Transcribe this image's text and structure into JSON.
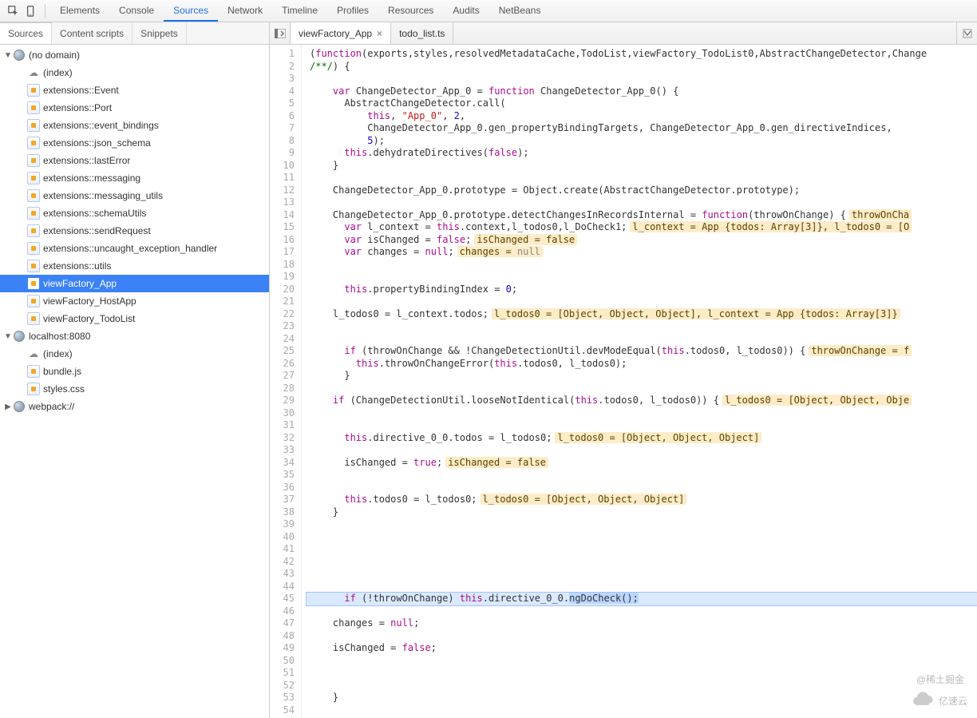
{
  "topTabs": [
    "Elements",
    "Console",
    "Sources",
    "Network",
    "Timeline",
    "Profiles",
    "Resources",
    "Audits",
    "NetBeans"
  ],
  "topActive": "Sources",
  "subTabs": [
    "Sources",
    "Content scripts",
    "Snippets"
  ],
  "subActive": "Sources",
  "fileTabs": [
    {
      "label": "viewFactory_App",
      "active": true,
      "closable": true
    },
    {
      "label": "todo_list.ts",
      "active": false,
      "closable": false
    }
  ],
  "tree": [
    {
      "type": "domain",
      "label": "(no domain)",
      "expanded": true,
      "children": [
        {
          "type": "file",
          "label": "(index)",
          "icon": "cloud"
        },
        {
          "type": "file",
          "label": "extensions::Event"
        },
        {
          "type": "file",
          "label": "extensions::Port"
        },
        {
          "type": "file",
          "label": "extensions::event_bindings"
        },
        {
          "type": "file",
          "label": "extensions::json_schema"
        },
        {
          "type": "file",
          "label": "extensions::lastError"
        },
        {
          "type": "file",
          "label": "extensions::messaging"
        },
        {
          "type": "file",
          "label": "extensions::messaging_utils"
        },
        {
          "type": "file",
          "label": "extensions::schemaUtils"
        },
        {
          "type": "file",
          "label": "extensions::sendRequest"
        },
        {
          "type": "file",
          "label": "extensions::uncaught_exception_handler"
        },
        {
          "type": "file",
          "label": "extensions::utils"
        },
        {
          "type": "file",
          "label": "viewFactory_App",
          "selected": true
        },
        {
          "type": "file",
          "label": "viewFactory_HostApp"
        },
        {
          "type": "file",
          "label": "viewFactory_TodoList"
        }
      ]
    },
    {
      "type": "domain",
      "label": "localhost:8080",
      "expanded": true,
      "children": [
        {
          "type": "file",
          "label": "(index)",
          "icon": "cloud"
        },
        {
          "type": "file",
          "label": "bundle.js"
        },
        {
          "type": "file",
          "label": "styles.css"
        }
      ]
    },
    {
      "type": "domain",
      "label": "webpack://",
      "expanded": false,
      "children": []
    }
  ],
  "code": {
    "startLine": 1,
    "highlightLine": 45,
    "lines": [
      [
        {
          "t": "(",
          "c": ""
        },
        {
          "t": "function",
          "c": "fn"
        },
        {
          "t": "(exports,styles,resolvedMetadataCache,TodoList,viewFactory_TodoList0,AbstractChangeDetector,Change",
          "c": ""
        }
      ],
      [
        {
          "t": "/**/",
          "c": "cmt"
        },
        {
          "t": ") {",
          "c": ""
        }
      ],
      [],
      [
        {
          "t": "    ",
          "c": ""
        },
        {
          "t": "var",
          "c": "kw"
        },
        {
          "t": " ChangeDetector_App_0 = ",
          "c": ""
        },
        {
          "t": "function",
          "c": "fn"
        },
        {
          "t": " ChangeDetector_App_0() {",
          "c": ""
        }
      ],
      [
        {
          "t": "      AbstractChangeDetector.call(",
          "c": ""
        }
      ],
      [
        {
          "t": "          ",
          "c": ""
        },
        {
          "t": "this",
          "c": "this"
        },
        {
          "t": ", ",
          "c": ""
        },
        {
          "t": "\"App_0\"",
          "c": "str"
        },
        {
          "t": ", ",
          "c": ""
        },
        {
          "t": "2",
          "c": "num"
        },
        {
          "t": ",",
          "c": ""
        }
      ],
      [
        {
          "t": "          ChangeDetector_App_0.gen_propertyBindingTargets, ChangeDetector_App_0.gen_directiveIndices,",
          "c": ""
        }
      ],
      [
        {
          "t": "          ",
          "c": ""
        },
        {
          "t": "5",
          "c": "num"
        },
        {
          "t": ");",
          "c": ""
        }
      ],
      [
        {
          "t": "      ",
          "c": ""
        },
        {
          "t": "this",
          "c": "this"
        },
        {
          "t": ".dehydrateDirectives(",
          "c": ""
        },
        {
          "t": "false",
          "c": "kw"
        },
        {
          "t": ");",
          "c": ""
        }
      ],
      [
        {
          "t": "    }",
          "c": ""
        }
      ],
      [],
      [
        {
          "t": "    ChangeDetector_App_0.prototype = Object.create(AbstractChangeDetector.prototype);",
          "c": ""
        }
      ],
      [],
      [
        {
          "t": "    ChangeDetector_App_0.prototype.detectChangesInRecordsInternal = ",
          "c": ""
        },
        {
          "t": "function",
          "c": "fn"
        },
        {
          "t": "(throwOnChange) {",
          "c": ""
        },
        {
          "inl": "throwOnCha"
        }
      ],
      [
        {
          "t": "      ",
          "c": ""
        },
        {
          "t": "var",
          "c": "kw"
        },
        {
          "t": " l_context = ",
          "c": ""
        },
        {
          "t": "this",
          "c": "this"
        },
        {
          "t": ".context,l_todos0,l_DoCheck1;",
          "c": ""
        },
        {
          "inl": "l_context = App {todos: Array[3]}, l_todos0 = [O"
        }
      ],
      [
        {
          "t": "      ",
          "c": ""
        },
        {
          "t": "var",
          "c": "kw"
        },
        {
          "t": " isChanged = ",
          "c": ""
        },
        {
          "t": "false",
          "c": "kw"
        },
        {
          "t": ";",
          "c": ""
        },
        {
          "inl": "isChanged = false"
        }
      ],
      [
        {
          "t": "      ",
          "c": ""
        },
        {
          "t": "var",
          "c": "kw"
        },
        {
          "t": " changes = ",
          "c": ""
        },
        {
          "t": "null",
          "c": "kw"
        },
        {
          "t": ";",
          "c": ""
        },
        {
          "inl": "changes = ",
          "inlx": "null"
        }
      ],
      [],
      [],
      [
        {
          "t": "      ",
          "c": ""
        },
        {
          "t": "this",
          "c": "this"
        },
        {
          "t": ".propertyBindingIndex = ",
          "c": ""
        },
        {
          "t": "0",
          "c": "num"
        },
        {
          "t": ";",
          "c": ""
        }
      ],
      [],
      [
        {
          "t": "    l_todos0 = l_context.todos;",
          "c": ""
        },
        {
          "inl": "l_todos0 = [Object, Object, Object], l_context = App {todos: Array[3]}"
        }
      ],
      [],
      [],
      [
        {
          "t": "      ",
          "c": ""
        },
        {
          "t": "if",
          "c": "kw"
        },
        {
          "t": " (throwOnChange && !ChangeDetectionUtil.devModeEqual(",
          "c": ""
        },
        {
          "t": "this",
          "c": "this"
        },
        {
          "t": ".todos0, l_todos0)) {",
          "c": ""
        },
        {
          "inl": "throwOnChange = f"
        }
      ],
      [
        {
          "t": "        ",
          "c": ""
        },
        {
          "t": "this",
          "c": "this"
        },
        {
          "t": ".throwOnChangeError(",
          "c": ""
        },
        {
          "t": "this",
          "c": "this"
        },
        {
          "t": ".todos0, l_todos0);",
          "c": ""
        }
      ],
      [
        {
          "t": "      }",
          "c": ""
        }
      ],
      [],
      [
        {
          "t": "    ",
          "c": ""
        },
        {
          "t": "if",
          "c": "kw"
        },
        {
          "t": " (ChangeDetectionUtil.looseNotIdentical(",
          "c": ""
        },
        {
          "t": "this",
          "c": "this"
        },
        {
          "t": ".todos0, l_todos0)) {",
          "c": ""
        },
        {
          "inl": "l_todos0 = [Object, Object, Obje"
        }
      ],
      [],
      [],
      [
        {
          "t": "      ",
          "c": ""
        },
        {
          "t": "this",
          "c": "this"
        },
        {
          "t": ".directive_0_0.todos = l_todos0;",
          "c": ""
        },
        {
          "inl": "l_todos0 = [Object, Object, Object]"
        }
      ],
      [],
      [
        {
          "t": "      isChanged = ",
          "c": ""
        },
        {
          "t": "true",
          "c": "kw"
        },
        {
          "t": ";",
          "c": ""
        },
        {
          "inl": "isChanged = false"
        }
      ],
      [],
      [],
      [
        {
          "t": "      ",
          "c": ""
        },
        {
          "t": "this",
          "c": "this"
        },
        {
          "t": ".todos0 = l_todos0;",
          "c": ""
        },
        {
          "inl": "l_todos0 = [Object, Object, Object]"
        }
      ],
      [
        {
          "t": "    }",
          "c": ""
        }
      ],
      [],
      [],
      [],
      [],
      [],
      [],
      [
        {
          "t": "      ",
          "c": ""
        },
        {
          "t": "if",
          "c": "kw"
        },
        {
          "t": " (!throwOnChange) ",
          "c": ""
        },
        {
          "t": "this",
          "c": "this"
        },
        {
          "t": ".directive_0_0.",
          "c": ""
        },
        {
          "sel": "ngDoCheck();"
        }
      ],
      [],
      [
        {
          "t": "    changes = ",
          "c": ""
        },
        {
          "t": "null",
          "c": "kw"
        },
        {
          "t": ";",
          "c": ""
        }
      ],
      [],
      [
        {
          "t": "    isChanged = ",
          "c": ""
        },
        {
          "t": "false",
          "c": "kw"
        },
        {
          "t": ";",
          "c": ""
        }
      ],
      [],
      [],
      [],
      [
        {
          "t": "    }",
          "c": ""
        }
      ],
      []
    ]
  },
  "watermarks": {
    "a": "@稀土掘金",
    "b": "亿速云"
  }
}
